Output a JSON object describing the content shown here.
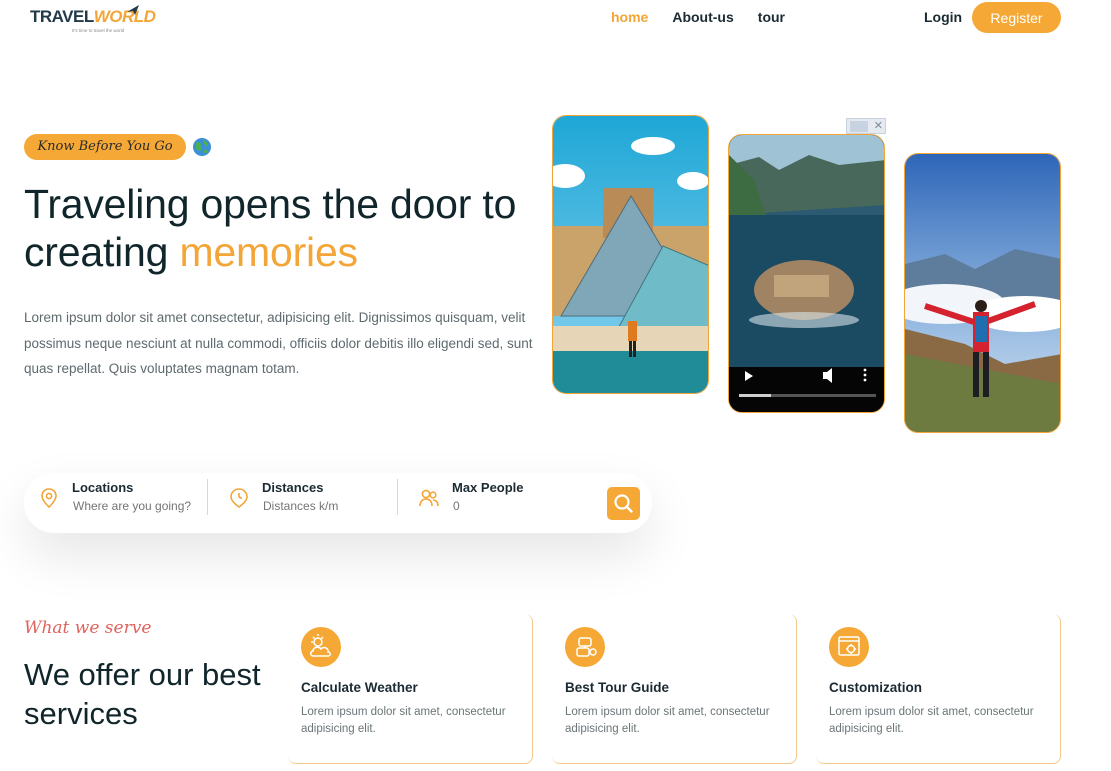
{
  "header": {
    "logo_travel": "TRAVEL",
    "logo_world": "WORLD",
    "logo_tagline": "It's time to travel the world",
    "nav": [
      {
        "label": "home",
        "active": true
      },
      {
        "label": "About-us",
        "active": false
      },
      {
        "label": "tour",
        "active": false
      }
    ],
    "login_label": "Login",
    "register_label": "Register"
  },
  "hero": {
    "badge": "Know Before You Go",
    "title_main": "Traveling opens the door to creating ",
    "title_highlight": "memories",
    "description": "Lorem ipsum dolor sit amet consectetur, adipisicing elit. Dignissimos quisquam, velit possimus neque nesciunt at nulla commodi, officiis dolor debitis illo eligendi sed, sunt quas repellat. Quis voluptates magnam totam."
  },
  "search": {
    "location": {
      "label": "Locations",
      "placeholder": "Where are you going?"
    },
    "distance": {
      "label": "Distances",
      "placeholder": "Distances k/m"
    },
    "people": {
      "label": "Max People",
      "placeholder": "0"
    }
  },
  "services": {
    "subtitle": "What we serve",
    "title": "We offer our best services",
    "cards": [
      {
        "icon": "weather-icon",
        "title": "Calculate Weather",
        "description": "Lorem ipsum dolor sit amet, consectetur adipisicing elit."
      },
      {
        "icon": "guide-icon",
        "title": "Best Tour Guide",
        "description": "Lorem ipsum dolor sit amet, consectetur adipisicing elit."
      },
      {
        "icon": "customization-icon",
        "title": "Customization",
        "description": "Lorem ipsum dolor sit amet, consectetur adipisicing elit."
      }
    ]
  },
  "colors": {
    "accent": "#f5a835",
    "heading": "#10262b",
    "serve_label": "#e0635b"
  }
}
